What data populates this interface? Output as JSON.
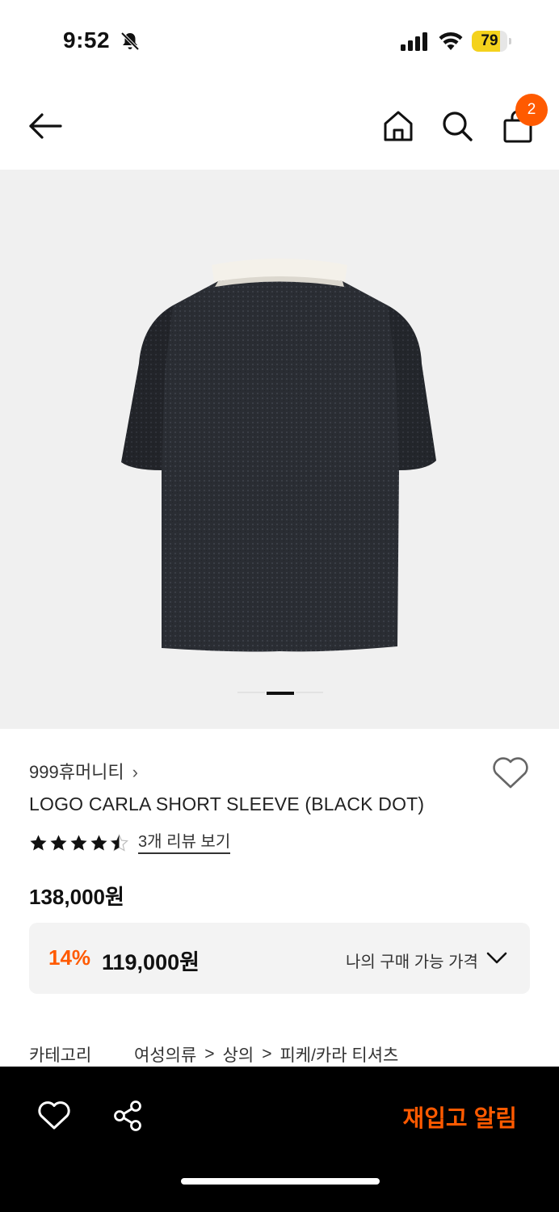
{
  "status_bar": {
    "time": "9:52",
    "battery": "79",
    "battery_level": 0.79,
    "icons": [
      "bell-off-icon",
      "signal-icon",
      "wifi-icon",
      "battery-icon"
    ]
  },
  "nav": {
    "icons": [
      "back-arrow-icon",
      "home-icon",
      "search-icon",
      "shopping-bag-icon"
    ],
    "cart_count": "2"
  },
  "gallery": {
    "image": "black short sleeve polo shirt with white collar",
    "pages": 3,
    "active_page": 2
  },
  "product": {
    "brand": "999휴머니티",
    "brand_chevron": "›",
    "name": "LOGO CARLA SHORT SLEEVE (BLACK DOT)",
    "rating": 4.5,
    "review_link": "3개 리뷰 보기",
    "original_price": "138,000원",
    "discount_rate": "14%",
    "sale_price": "119,000원",
    "my_price_label": "나의 구매 가능 가격"
  },
  "category": {
    "label": "카테고리",
    "path": [
      "여성의류",
      "상의",
      "피케/카라 티셔츠"
    ],
    "separator": ">"
  },
  "bottom_bar": {
    "restock_label": "재입고 알림"
  },
  "colors": {
    "accent": "#ff5a00",
    "battery": "#f4d21c",
    "bottom_bar": "#000000",
    "image_bg": "#f0f0f0"
  }
}
